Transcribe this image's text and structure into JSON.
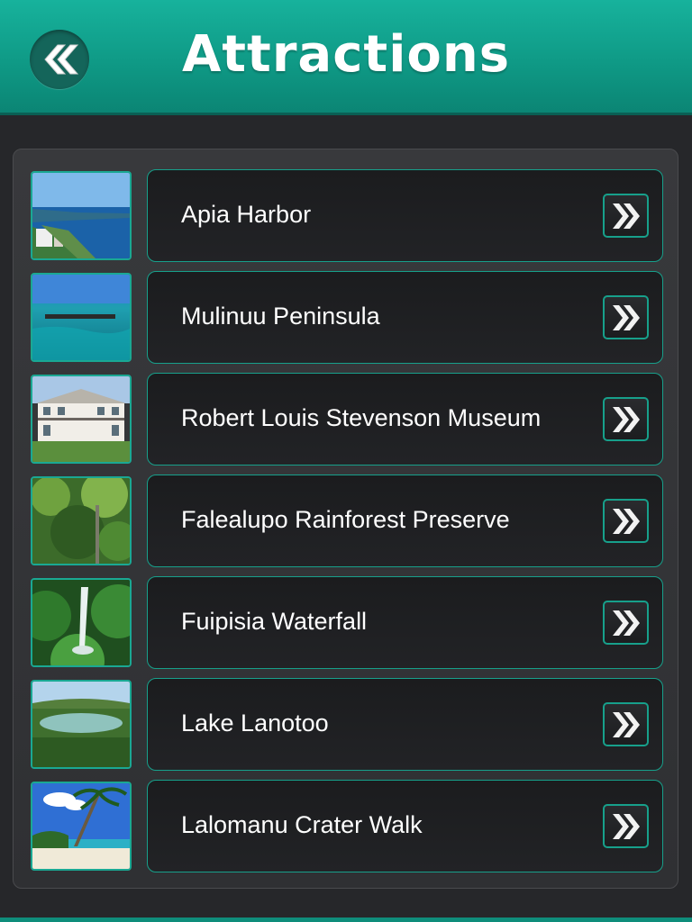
{
  "header": {
    "title": "Attractions",
    "back_icon": "double-chevron-left-icon",
    "accent_color": "#12a38e"
  },
  "list": {
    "item_icon": "double-chevron-right-icon",
    "items": [
      {
        "label": "Apia Harbor",
        "thumbnail": "harbor-photo"
      },
      {
        "label": "Mulinuu Peninsula",
        "thumbnail": "ocean-boat-photo"
      },
      {
        "label": "Robert Louis Stevenson Museum",
        "thumbnail": "mansion-photo"
      },
      {
        "label": "Falealupo Rainforest Preserve",
        "thumbnail": "rainforest-photo"
      },
      {
        "label": "Fuipisia Waterfall",
        "thumbnail": "waterfall-photo"
      },
      {
        "label": "Lake Lanotoo",
        "thumbnail": "crater-lake-photo"
      },
      {
        "label": "Lalomanu Crater Walk",
        "thumbnail": "palm-beach-photo"
      }
    ]
  }
}
